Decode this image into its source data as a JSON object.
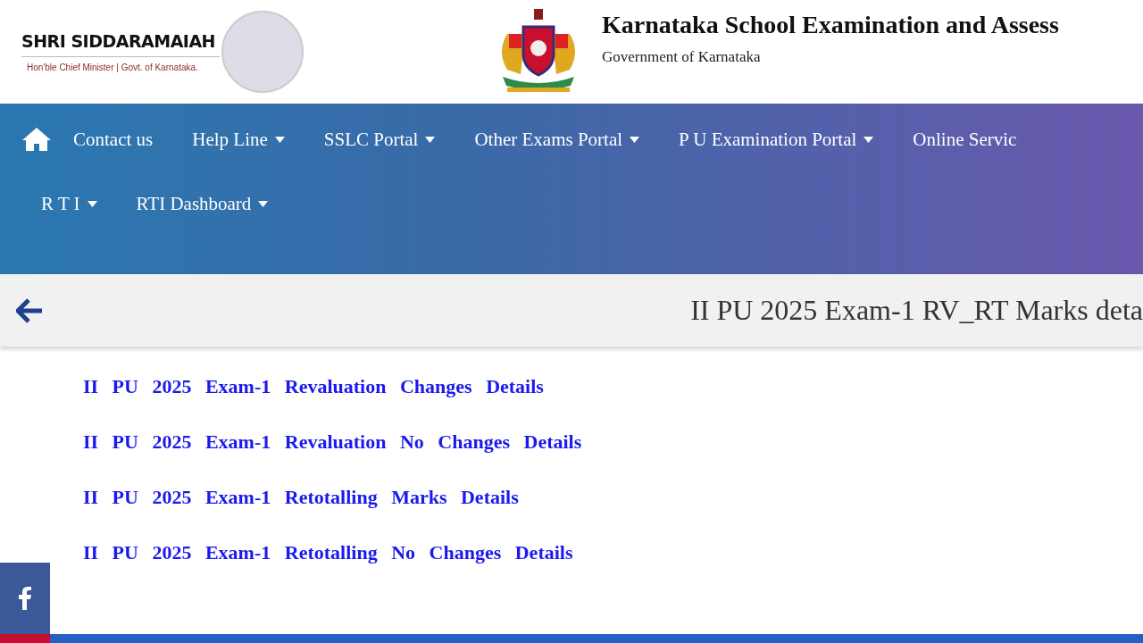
{
  "header": {
    "leader_name": "SHRI SIDDARAMAIAH",
    "leader_role": "Hon'ble Chief Minister | Govt. of Karnataka.",
    "org_title": "Karnataka School Examination and Assess",
    "org_subtitle": "Government of Karnataka"
  },
  "nav": {
    "items": [
      {
        "label": "Contact us",
        "has_menu": false
      },
      {
        "label": "Help Line",
        "has_menu": true
      },
      {
        "label": "SSLC Portal",
        "has_menu": true
      },
      {
        "label": "Other Exams Portal",
        "has_menu": true
      },
      {
        "label": "P U Examination Portal",
        "has_menu": true
      },
      {
        "label": "Online Servic",
        "has_menu": false
      },
      {
        "label": "R T I",
        "has_menu": true
      },
      {
        "label": "RTI Dashboard",
        "has_menu": true
      }
    ]
  },
  "page_title": "II PU 2025 Exam-1 RV_RT Marks deta",
  "links": [
    "II PU 2025 Exam-1 Revaluation Changes Details",
    "II PU 2025 Exam-1 Revaluation No Changes Details",
    "II PU 2025 Exam-1 Retotalling Marks Details",
    "II PU 2025 Exam-1 Retotalling No Changes Details"
  ]
}
